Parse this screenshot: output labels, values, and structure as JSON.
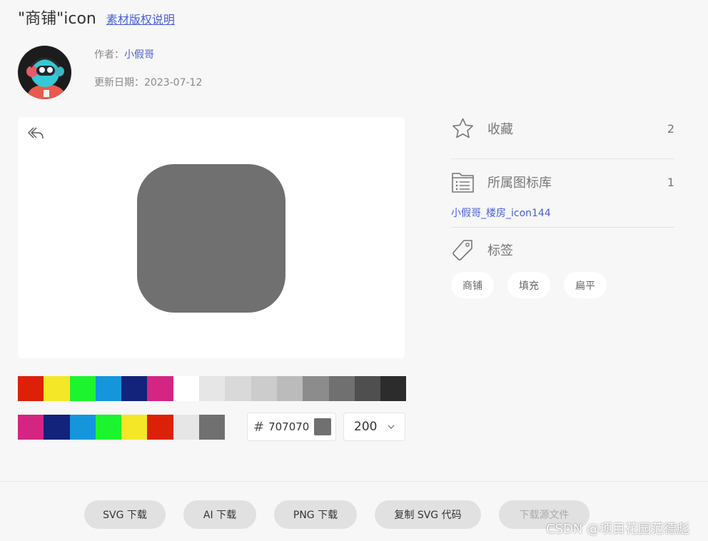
{
  "header": {
    "title": "\"商铺\"icon",
    "copyright_link": "素材版权说明"
  },
  "meta": {
    "author_label": "作者：",
    "author_name": "小假哥",
    "date_label": "更新日期：",
    "date_value": "2023-07-12"
  },
  "preview": {
    "icon_color": "#707070"
  },
  "palette": {
    "row1": [
      "#dd2008",
      "#f4e728",
      "#1cf52d",
      "#1596dc",
      "#13227a",
      "#d52583",
      "#ffffff",
      "#e6e6e6",
      "#d9d9d9",
      "#cccccc",
      "#bbbbbb",
      "#8c8c8c",
      "#707070",
      "#4f4f4f",
      "#2c2c2c"
    ],
    "row2": [
      "#d52583",
      "#13227a",
      "#1596dc",
      "#1cf52d",
      "#f4e728",
      "#dd2008",
      "#e6e6e6",
      "#707070"
    ]
  },
  "color_input": {
    "hash": "#",
    "value": "707070"
  },
  "size_select": {
    "value": "200"
  },
  "sidebar": {
    "favorites": {
      "label": "收藏",
      "count": "2",
      "icon": "star-icon"
    },
    "library": {
      "label": "所属图标库",
      "count": "1",
      "icon": "folder-list-icon",
      "link": "小假哥_楼房_icon144"
    },
    "tags": {
      "label": "标签",
      "icon": "tag-icon",
      "items": [
        "商铺",
        "填充",
        "扁平"
      ]
    }
  },
  "footer": {
    "buttons": [
      "SVG 下载",
      "AI 下载",
      "PNG 下载",
      "复制 SVG 代码",
      "下载源文件"
    ],
    "watermark": "CSDN @项目花园范德彪"
  }
}
